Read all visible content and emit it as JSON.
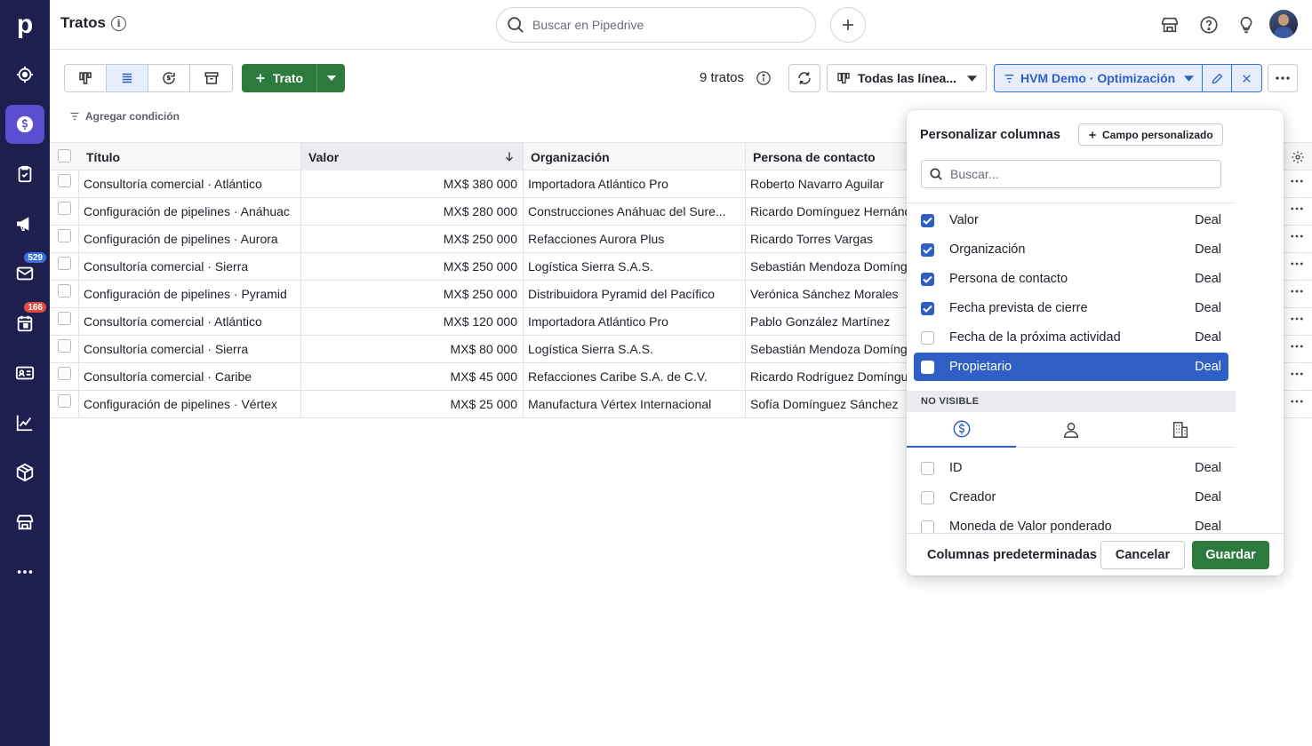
{
  "app": {
    "logo": "p",
    "page_title": "Tratos"
  },
  "sidebar": {
    "items": [
      {
        "icon": "target-icon"
      },
      {
        "icon": "deals-dollar-icon",
        "active": true
      },
      {
        "icon": "tasks-clipboard-icon"
      },
      {
        "icon": "campaigns-megaphone-icon"
      },
      {
        "icon": "mail-icon",
        "badge": "529",
        "badge_color": "#3b6fd8"
      },
      {
        "icon": "calendar-icon",
        "badge": "166",
        "badge_color": "#e04a3f"
      },
      {
        "icon": "contacts-card-icon"
      },
      {
        "icon": "insights-chart-icon"
      },
      {
        "icon": "products-box-icon"
      },
      {
        "icon": "marketplace-store-icon"
      },
      {
        "icon": "more-dots-icon"
      }
    ]
  },
  "topbar": {
    "search_placeholder": "Buscar en Pipedrive"
  },
  "toolbar": {
    "new_deal_label": "Trato",
    "deal_count": "9 tratos",
    "pipeline_label": "Todas las línea...",
    "filter_label": "HVM Demo · Optimización",
    "add_condition": "Agregar condición"
  },
  "table": {
    "columns": [
      "Título",
      "Valor",
      "Organización",
      "Persona de contacto"
    ],
    "rows": [
      {
        "title": "Consultoría comercial · Atlántico",
        "value": "MX$ 380 000",
        "org": "Importadora Atlántico Pro",
        "contact": "Roberto Navarro Aguilar"
      },
      {
        "title": "Configuración de pipelines · Anáhuac",
        "value": "MX$ 280 000",
        "org": "Construcciones Anáhuac del Sure...",
        "contact": "Ricardo Domínguez Hernández"
      },
      {
        "title": "Configuración de pipelines · Aurora",
        "value": "MX$ 250 000",
        "org": "Refacciones Aurora Plus",
        "contact": "Ricardo Torres Vargas"
      },
      {
        "title": "Consultoría comercial · Sierra",
        "value": "MX$ 250 000",
        "org": "Logística Sierra S.A.S.",
        "contact": "Sebastián Mendoza Domínguez"
      },
      {
        "title": "Configuración de pipelines · Pyramid",
        "value": "MX$ 250 000",
        "org": "Distribuidora Pyramid del Pacífico",
        "contact": "Verónica Sánchez Morales"
      },
      {
        "title": "Consultoría comercial · Atlántico",
        "value": "MX$ 120 000",
        "org": "Importadora Atlántico Pro",
        "contact": "Pablo González Martínez"
      },
      {
        "title": "Consultoría comercial · Sierra",
        "value": "MX$ 80 000",
        "org": "Logística Sierra S.A.S.",
        "contact": "Sebastián Mendoza Domínguez"
      },
      {
        "title": "Consultoría comercial · Caribe",
        "value": "MX$ 45 000",
        "org": "Refacciones Caribe S.A. de C.V.",
        "contact": "Ricardo Rodríguez Domínguez"
      },
      {
        "title": "Configuración de pipelines · Vértex",
        "value": "MX$ 25 000",
        "org": "Manufactura Vértex Internacional",
        "contact": "Sofía Domínguez Sánchez"
      }
    ]
  },
  "popover": {
    "title": "Personalizar columnas",
    "custom_field_label": "Campo personalizado",
    "search_placeholder": "Buscar...",
    "visible_columns": [
      {
        "label": "Valor",
        "type": "Deal",
        "checked": true
      },
      {
        "label": "Organización",
        "type": "Deal",
        "checked": true
      },
      {
        "label": "Persona de contacto",
        "type": "Deal",
        "checked": true
      },
      {
        "label": "Fecha prevista de cierre",
        "type": "Deal",
        "checked": true
      },
      {
        "label": "Fecha de la próxima actividad",
        "type": "Deal",
        "checked": false
      },
      {
        "label": "Propietario",
        "type": "Deal",
        "checked": false,
        "highlighted": true
      }
    ],
    "not_visible_label": "NO VISIBLE",
    "hidden_columns": [
      {
        "label": "ID",
        "type": "Deal",
        "checked": false
      },
      {
        "label": "Creador",
        "type": "Deal",
        "checked": false
      },
      {
        "label": "Moneda de Valor ponderado",
        "type": "Deal",
        "checked": false
      }
    ],
    "default_columns_label": "Columnas predeterminadas",
    "cancel_label": "Cancelar",
    "save_label": "Guardar"
  },
  "colors": {
    "sidebar_bg": "#1e1e4f",
    "sidebar_active": "#5a4fd1",
    "primary_green": "#2d7a3d",
    "accent_blue": "#2f5ec4"
  }
}
